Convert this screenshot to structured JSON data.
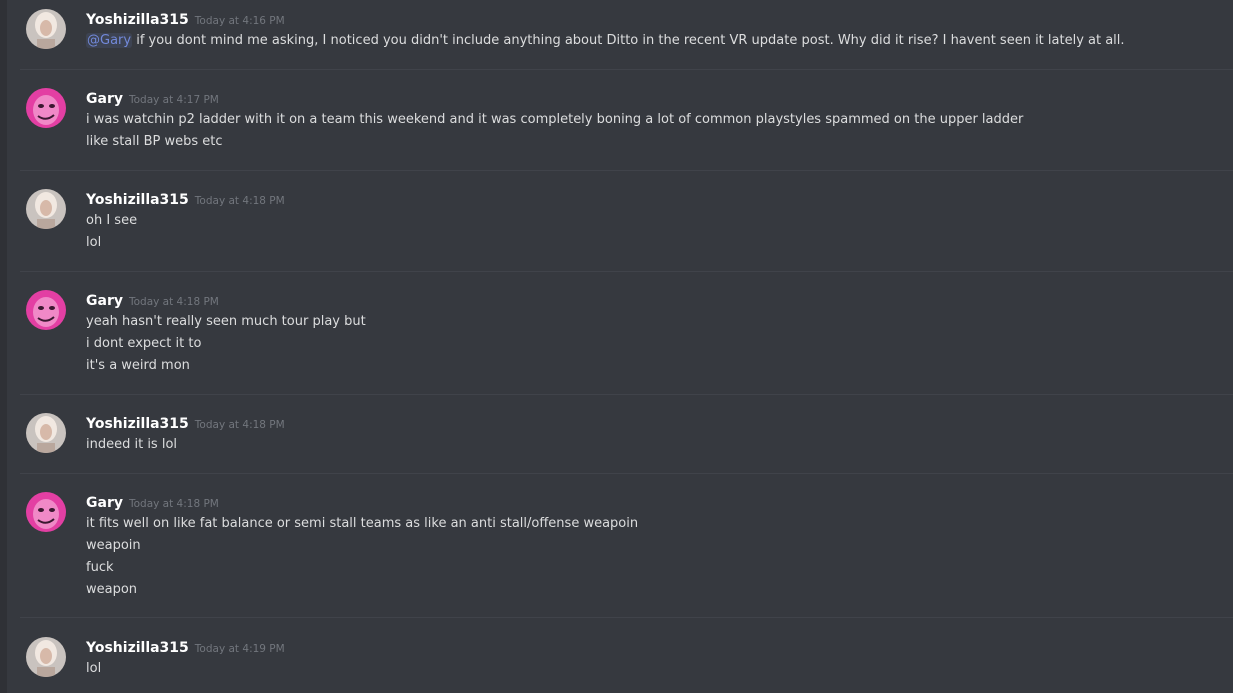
{
  "colors": {
    "background": "#36393f",
    "divider": "#40434a",
    "username": "#ffffff",
    "timestamp": "#72767d",
    "text": "#dcddde",
    "mention": "#7289da"
  },
  "messages": [
    {
      "author": "Yoshizilla315",
      "avatar": "yoshizilla-avatar",
      "timestamp": "Today at 4:16 PM",
      "mention": "@Gary",
      "lines": [
        " if you dont mind me asking, I noticed you didn't include anything about Ditto in the recent VR update post. Why did it rise? I havent seen it lately at all."
      ]
    },
    {
      "author": "Gary",
      "avatar": "gary-avatar",
      "timestamp": "Today at 4:17 PM",
      "lines": [
        "i was watchin p2 ladder with it on a team this weekend and it was completely boning a lot of common playstyles spammed on the upper ladder",
        "like stall BP webs etc"
      ]
    },
    {
      "author": "Yoshizilla315",
      "avatar": "yoshizilla-avatar",
      "timestamp": "Today at 4:18 PM",
      "lines": [
        "oh I see",
        "lol"
      ]
    },
    {
      "author": "Gary",
      "avatar": "gary-avatar",
      "timestamp": "Today at 4:18 PM",
      "lines": [
        "yeah hasn't really seen much tour play but",
        "i dont expect it to",
        "it's a weird mon"
      ]
    },
    {
      "author": "Yoshizilla315",
      "avatar": "yoshizilla-avatar",
      "timestamp": "Today at 4:18 PM",
      "lines": [
        "indeed it is lol"
      ]
    },
    {
      "author": "Gary",
      "avatar": "gary-avatar",
      "timestamp": "Today at 4:18 PM",
      "lines": [
        "it fits well on like fat balance or semi stall teams as like an anti stall/offense weapoin",
        "weapoin",
        "fuck",
        "weapon"
      ]
    },
    {
      "author": "Yoshizilla315",
      "avatar": "yoshizilla-avatar",
      "timestamp": "Today at 4:19 PM",
      "lines": [
        "lol"
      ]
    }
  ]
}
